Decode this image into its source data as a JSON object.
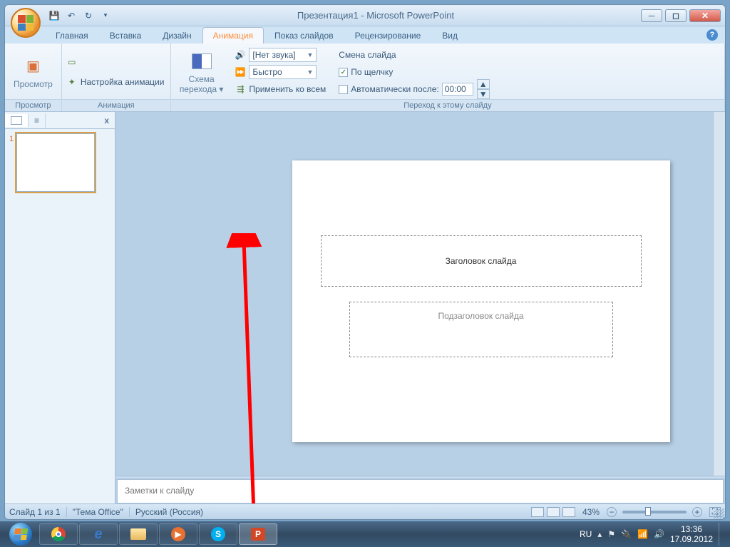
{
  "title": "Презентация1 - Microsoft PowerPoint",
  "tabs": [
    "Главная",
    "Вставка",
    "Дизайн",
    "Анимация",
    "Показ слайдов",
    "Рецензирование",
    "Вид"
  ],
  "active_tab_index": 3,
  "ribbon": {
    "g1": {
      "label": "Просмотр",
      "btn": "Просмотр"
    },
    "g2": {
      "label": "Анимация",
      "btn": "Настройка анимации"
    },
    "g3": {
      "label": "Переход к этому слайду",
      "scheme": "Схема",
      "scheme2": "перехода",
      "sound": "[Нет звука]",
      "speed": "Быстро",
      "apply": "Применить ко всем",
      "change_title": "Смена слайда",
      "onclick": "По щелчку",
      "auto": "Автоматически после:",
      "time": "00:00"
    }
  },
  "thumb_num": "1",
  "slide": {
    "title": "Заголовок слайда",
    "subtitle": "Подзаголовок слайда"
  },
  "notes": "Заметки к слайду",
  "status": {
    "slide": "Слайд 1 из 1",
    "theme": "\"Тема Office\"",
    "lang_full": "Русский (Россия)",
    "zoom": "43%"
  },
  "tray": {
    "lang": "RU",
    "time": "13:36",
    "date": "17.09.2012"
  }
}
